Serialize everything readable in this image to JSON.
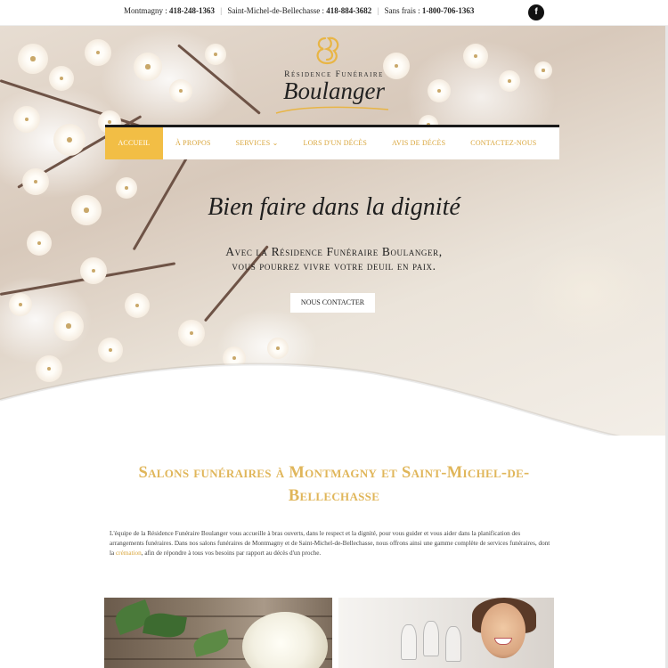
{
  "topbar": {
    "contacts": [
      {
        "label": "Montmagny :",
        "phone": "418-248-1363"
      },
      {
        "label": "Saint-Michel-de-Bellechasse :",
        "phone": "418-884-3682"
      },
      {
        "label": "Sans frais :",
        "phone": "1-800-706-1363"
      }
    ],
    "facebook_icon": "f"
  },
  "logo": {
    "line1": "Résidence Funéraire",
    "line2": "Boulanger"
  },
  "nav": {
    "items": [
      {
        "label": "ACCUEIL",
        "active": true
      },
      {
        "label": "À PROPOS",
        "active": false
      },
      {
        "label": "SERVICES ⌄",
        "active": false
      },
      {
        "label": "LORS D'UN DÉCÈS",
        "active": false
      },
      {
        "label": "AVIS DE DÉCÈS",
        "active": false
      },
      {
        "label": "CONTACTEZ-NOUS",
        "active": false
      }
    ]
  },
  "hero": {
    "tagline": "Bien faire dans la dignité",
    "subtitle_line1": "Avec la Résidence Funéraire Boulanger,",
    "subtitle_line2": "vous pourrez vivre votre deuil en paix.",
    "cta": "NOUS CONTACTER"
  },
  "main": {
    "title": "Salons funéraires à Montmagny et Saint-Michel-de-Bellechasse",
    "intro_before": "L'équipe de la Résidence Funéraire Boulanger vous accueille à bras ouverts, dans le respect et la dignité, pour vous guider et vous aider dans la planification des arrangements funéraires. Dans nos salons funéraires de Montmagny et de Saint-Michel-de-Bellechasse, nous offrons ainsi une gamme complète de services funéraires, dont la ",
    "intro_link": "crémation",
    "intro_after": ", afin de répondre à tous vos besoins par rapport au décès d'un proche."
  },
  "colors": {
    "accent": "#f2be45",
    "accent_text": "#d9a53a",
    "title_gold": "#e0b65a",
    "nav_border": "#1a1a1a"
  }
}
